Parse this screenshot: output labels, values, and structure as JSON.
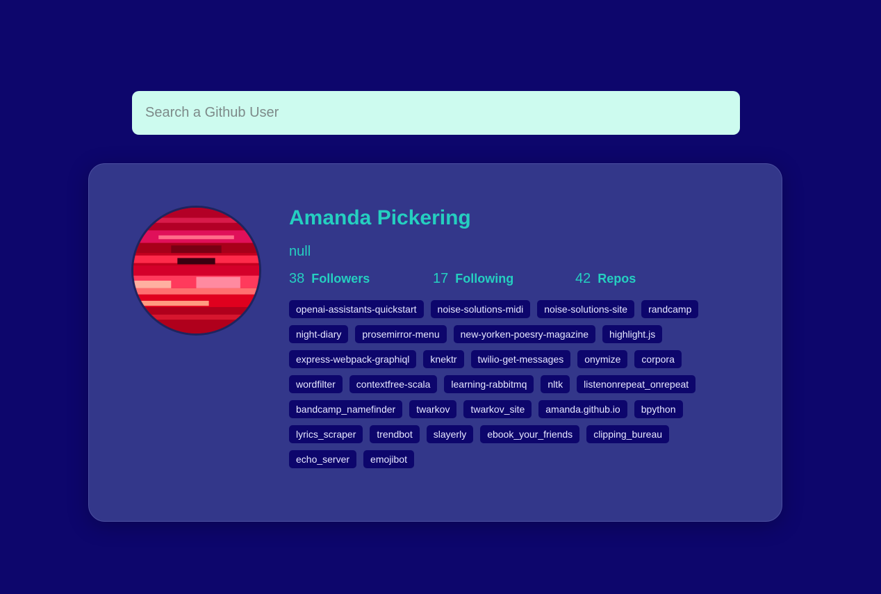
{
  "search": {
    "placeholder": "Search a Github User",
    "value": ""
  },
  "profile": {
    "name": "Amanda Pickering",
    "bio": "null",
    "followers": {
      "count": "38",
      "label": "Followers"
    },
    "following": {
      "count": "17",
      "label": "Following"
    },
    "repos": {
      "count": "42",
      "label": "Repos"
    },
    "repo_list": [
      "openai-assistants-quickstart",
      "noise-solutions-midi",
      "noise-solutions-site",
      "randcamp",
      "night-diary",
      "prosemirror-menu",
      "new-yorken-poesry-magazine",
      "highlight.js",
      "express-webpack-graphiql",
      "knektr",
      "twilio-get-messages",
      "onymize",
      "corpora",
      "wordfilter",
      "contextfree-scala",
      "learning-rabbitmq",
      "nltk",
      "listenonrepeat_onrepeat",
      "bandcamp_namefinder",
      "twarkov",
      "twarkov_site",
      "amanda.github.io",
      "bpython",
      "lyrics_scraper",
      "trendbot",
      "slayerly",
      "ebook_your_friends",
      "clipping_bureau",
      "echo_server",
      "emojibot"
    ]
  },
  "colors": {
    "background": "#0d066c",
    "card": "#33378a",
    "accent": "#25cfc0",
    "search_bg": "#cdfbef",
    "tag_bg": "#0d066c",
    "tag_text": "#e6e7ff"
  }
}
